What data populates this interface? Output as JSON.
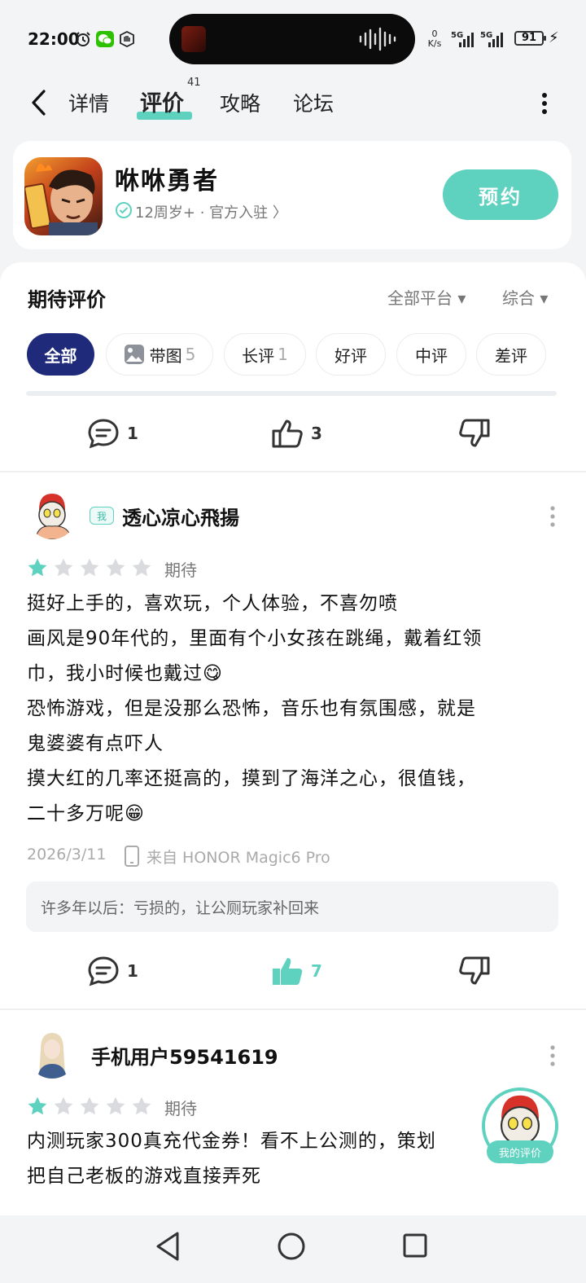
{
  "status_bar": {
    "time": "22:00",
    "net_speed_top": "0",
    "net_speed_unit": "K/s",
    "signal_1": "5G",
    "signal_2": "5G",
    "battery": "91"
  },
  "nav": {
    "tabs": [
      {
        "label": "详情"
      },
      {
        "label": "评价",
        "badge": "41",
        "active": true
      },
      {
        "label": "攻略"
      },
      {
        "label": "论坛"
      }
    ]
  },
  "app": {
    "name": "咻咻勇者",
    "meta": "12周岁+ · 官方入驻 〉",
    "reserve_label": "预约"
  },
  "reviews_section": {
    "title": "期待评价",
    "platform_filter": "全部平台 ▾",
    "sort_filter": "综合 ▾",
    "chips": [
      {
        "label": "全部",
        "count": ""
      },
      {
        "label": "带图",
        "count": "5"
      },
      {
        "label": "长评",
        "count": "1"
      },
      {
        "label": "好评",
        "count": ""
      },
      {
        "label": "中评",
        "count": ""
      },
      {
        "label": "差评",
        "count": ""
      }
    ]
  },
  "top_actions": {
    "comments": "1",
    "likes": "3"
  },
  "review1": {
    "me_tag": "我",
    "username": "透心凉心飛揚",
    "rating": 1,
    "status": "期待",
    "lines": [
      "挺好上手的，喜欢玩，个人体验，不喜勿喷",
      "画风是90年代的，里面有个小女孩在跳绳，戴着红领",
      "巾，我小时候也戴过😋",
      "恐怖游戏，但是没那么恐怖，音乐也有氛围感，就是",
      "鬼婆婆有点吓人",
      "摸大红的几率还挺高的，摸到了海洋之心，很值钱，",
      "二十多万呢😁"
    ],
    "date": "2026/3/11",
    "device": "来自 HONOR Magic6 Pro",
    "reply": "许多年以后：亏损的，让公厕玩家补回来",
    "comments": "1",
    "likes": "7"
  },
  "review2": {
    "username": "手机用户59541619",
    "rating": 1,
    "status": "期待",
    "lines": [
      "内测玩家300真充代金券！看不上公测的，策划",
      "把自己老板的游戏直接弄死"
    ]
  },
  "floating": {
    "label": "我的评价"
  },
  "colors": {
    "accent": "#5ed1bf",
    "chip_active": "#1f2a7a"
  }
}
